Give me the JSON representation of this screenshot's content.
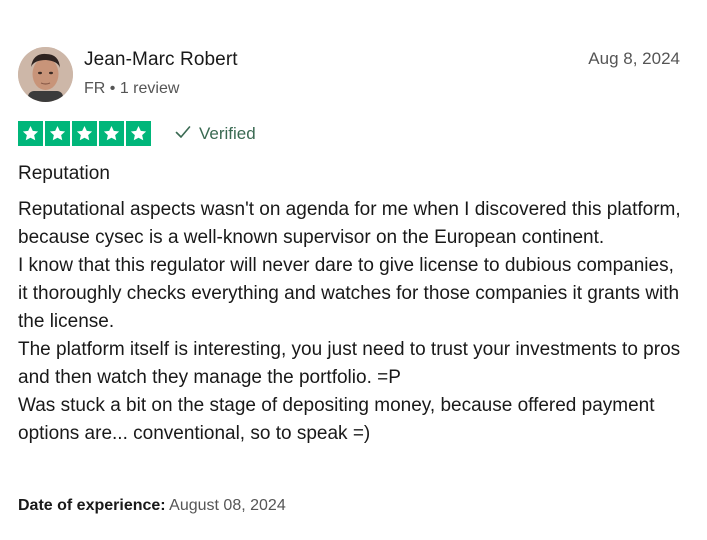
{
  "reviewer": {
    "name": "Jean-Marc Robert",
    "meta": "FR • 1 review"
  },
  "review": {
    "date": "Aug 8, 2024",
    "rating": 5,
    "verified_label": "Verified",
    "title": "Reputation",
    "body_lines": [
      "Reputational aspects wasn't on agenda for me when I discovered this platform, because cysec is a well-known supervisor on the European continent.",
      "I know that this regulator will never dare to give license to dubious companies, it thoroughly checks everything and watches for those companies it grants with the license.",
      "The platform itself is interesting, you just need to trust your investments to pros and then watch they manage the portfolio. =P",
      "Was stuck a bit on the stage of depositing money, because offered payment options are... conventional, so to speak =)"
    ],
    "experience_label": "Date of experience:",
    "experience_date": "August 08, 2024"
  },
  "colors": {
    "star_green": "#00b67a",
    "verified_green": "#3a6a52"
  },
  "icons": {
    "star": "star-icon",
    "verified": "checkmark-icon"
  }
}
